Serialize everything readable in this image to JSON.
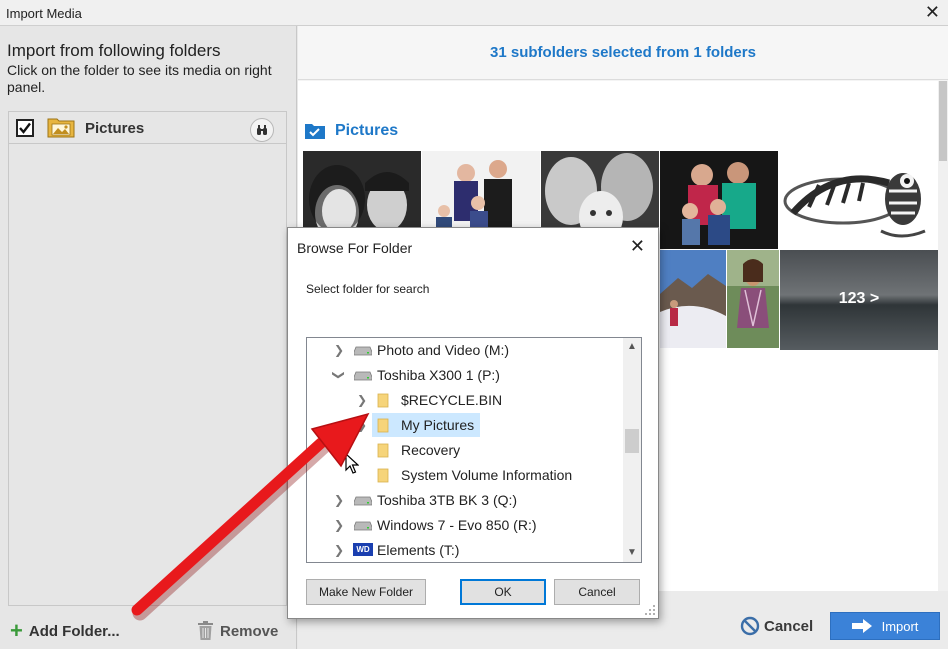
{
  "window": {
    "title": "Import Media",
    "close": "✕"
  },
  "left_panel": {
    "heading": "Import from following folders",
    "subtext": "Click on the folder to see its media on right panel.",
    "folders": [
      {
        "label": "Pictures",
        "checked": true
      }
    ],
    "add_folder": "Add Folder...",
    "remove": "Remove"
  },
  "right_panel": {
    "summary": "31 subfolders selected from 1 folders",
    "gallery_title": "Pictures",
    "more_label": "123 >",
    "cancel": "Cancel",
    "import": "Import"
  },
  "dialog": {
    "title": "Browse For Folder",
    "close": "✕",
    "instruction": "Select folder for search",
    "tree": [
      {
        "label": "Photo and Video (M:)",
        "type": "drive",
        "expanded": false,
        "level": 0
      },
      {
        "label": "Toshiba X300 1 (P:)",
        "type": "drive",
        "expanded": true,
        "level": 0
      },
      {
        "label": "$RECYCLE.BIN",
        "type": "folder",
        "expanded": false,
        "level": 1
      },
      {
        "label": "My Pictures",
        "type": "folder",
        "expanded": false,
        "level": 1,
        "selected": true
      },
      {
        "label": "Recovery",
        "type": "folder",
        "level": 1
      },
      {
        "label": "System Volume Information",
        "type": "folder",
        "level": 1
      },
      {
        "label": "Toshiba 3TB BK 3 (Q:)",
        "type": "drive",
        "expanded": false,
        "level": 0
      },
      {
        "label": "Windows 7 - Evo 850 (R:)",
        "type": "drive",
        "expanded": false,
        "level": 0
      },
      {
        "label": "Elements (T:)",
        "type": "wd-drive",
        "expanded": false,
        "level": 0
      }
    ],
    "wd_badge": "WD",
    "make_new_folder": "Make New Folder",
    "ok": "OK",
    "cancel": "Cancel"
  },
  "colors": {
    "accent_blue": "#1e78c8",
    "import_button": "#3b82d8",
    "selection": "#cce8ff",
    "annotation_arrow": "#e8191c",
    "add_plus": "#3a9a3a"
  }
}
